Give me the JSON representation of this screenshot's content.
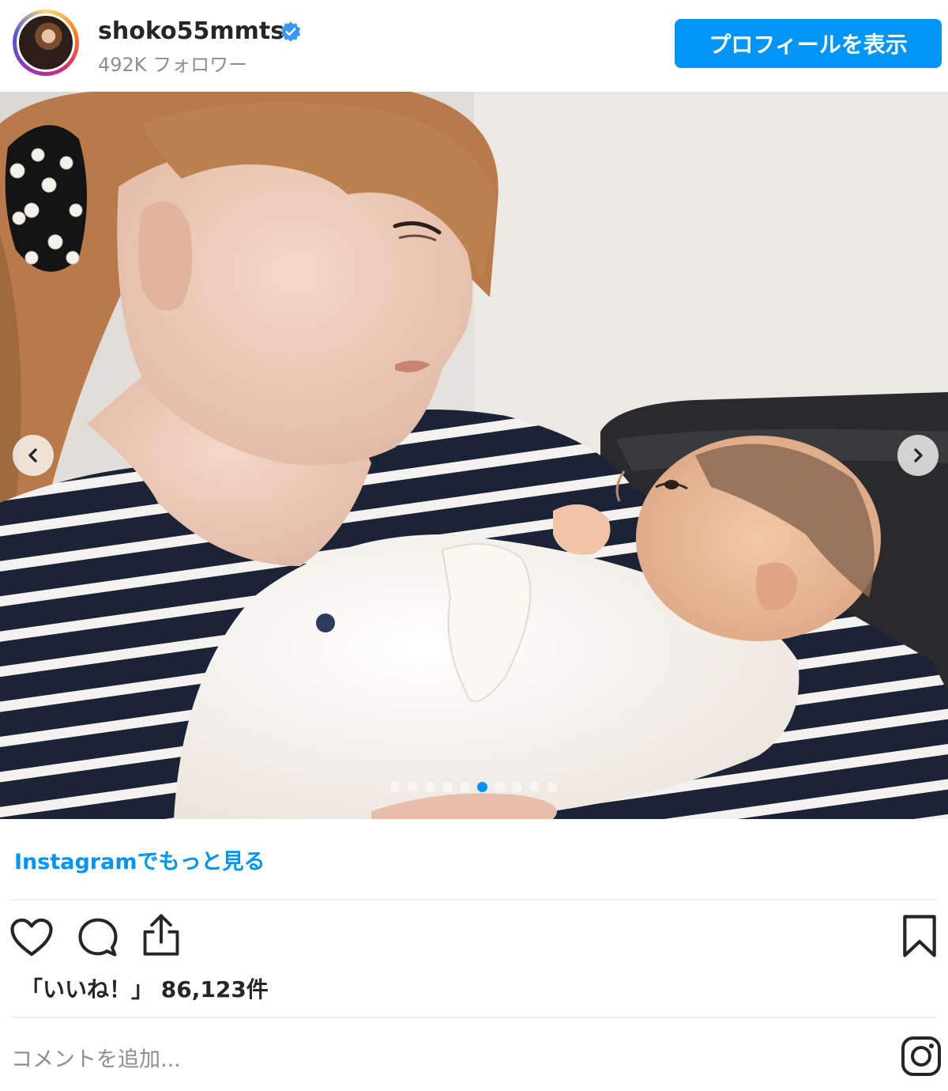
{
  "header": {
    "username": "shoko55mmts",
    "followers": "492K フォロワー",
    "profile_button": "プロフィールを表示"
  },
  "carousel": {
    "total_slides": 10,
    "active_slide": 6
  },
  "more_link": "Instagramでもっと見る",
  "likes": "「いいね！」 86,123件",
  "comment_placeholder": "コメントを追加...",
  "colors": {
    "accent": "#0095f6",
    "text": "#262626",
    "muted": "#8e8e8e"
  },
  "icons": [
    "verified-badge-icon",
    "chevron-left-icon",
    "chevron-right-icon",
    "heart-icon",
    "comment-icon",
    "share-icon",
    "bookmark-icon",
    "instagram-icon"
  ]
}
